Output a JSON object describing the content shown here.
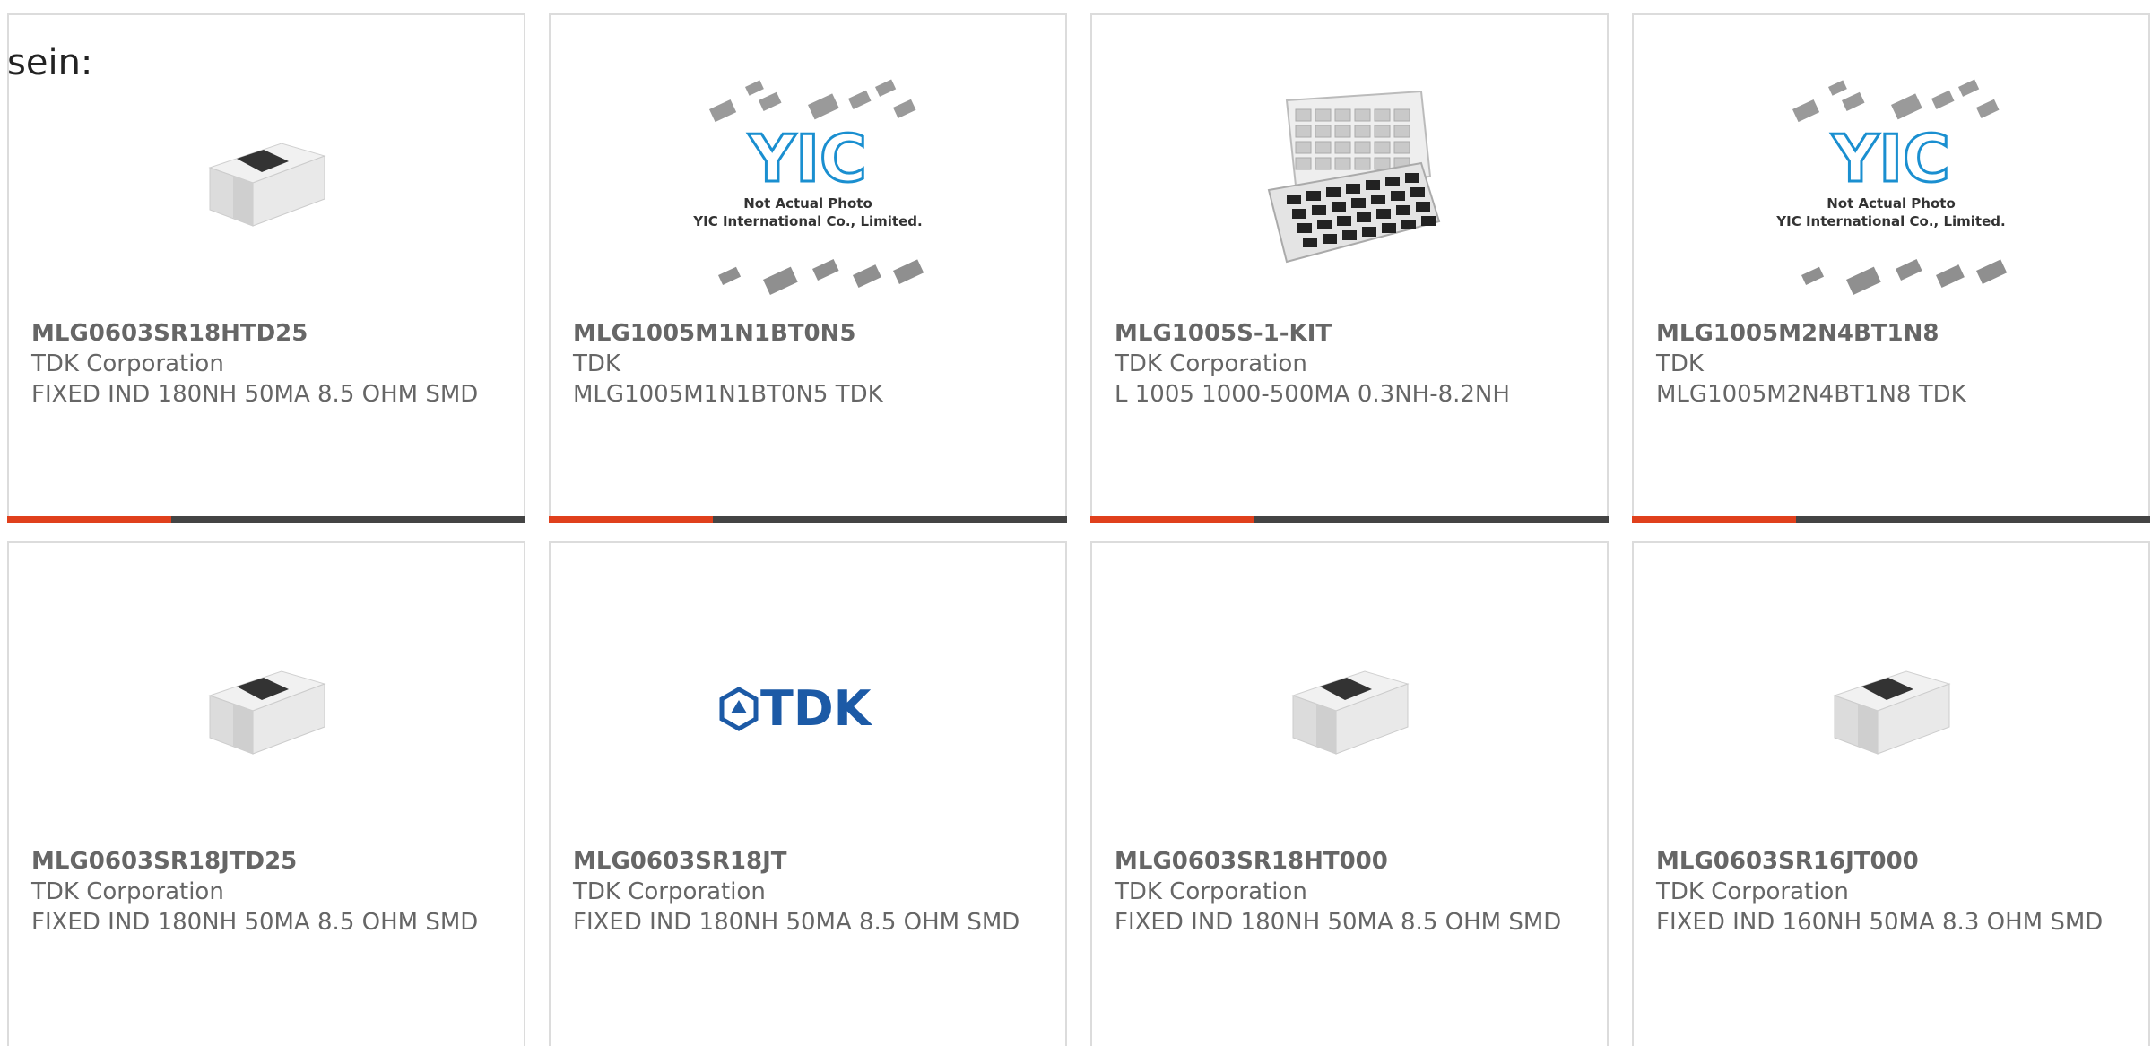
{
  "intro_text": "sein:",
  "products": [
    {
      "part": "MLG0603SR18HTD25",
      "maker": "TDK Corporation",
      "desc": "FIXED IND 180NH 50MA 8.5 OHM SMD",
      "image": "chip-inductor"
    },
    {
      "part": "MLG1005M1N1BT0N5",
      "maker": "TDK",
      "desc": "MLG1005M1N1BT0N5 TDK",
      "image": "yic-placeholder"
    },
    {
      "part": "MLG1005S-1-KIT",
      "maker": "TDK Corporation",
      "desc": "L 1005 1000-500MA 0.3NH-8.2NH",
      "image": "component-kit-box"
    },
    {
      "part": "MLG1005M2N4BT1N8",
      "maker": "TDK",
      "desc": "MLG1005M2N4BT1N8 TDK",
      "image": "yic-placeholder"
    },
    {
      "part": "MLG0603SR18JTD25",
      "maker": "TDK Corporation",
      "desc": "FIXED IND 180NH 50MA 8.5 OHM SMD",
      "image": "chip-inductor"
    },
    {
      "part": "MLG0603SR18JT",
      "maker": "TDK Corporation",
      "desc": "FIXED IND 180NH 50MA 8.5 OHM SMD",
      "image": "tdk-logo"
    },
    {
      "part": "MLG0603SR18HT000",
      "maker": "TDK Corporation",
      "desc": "FIXED IND 180NH 50MA 8.5 OHM SMD",
      "image": "chip-inductor"
    },
    {
      "part": "MLG0603SR16JT000",
      "maker": "TDK Corporation",
      "desc": "FIXED IND 160NH 50MA 8.3 OHM SMD",
      "image": "chip-inductor"
    }
  ],
  "placeholder": {
    "brand": "YIC",
    "line1": "Not Actual Photo",
    "line2": "YIC International Co., Limited."
  },
  "tdk_logo_text": "TDK",
  "colors": {
    "accent": "#e0401c",
    "bar_dark": "#444444",
    "text_gray": "#666666",
    "tdk_blue": "#1c5aa6",
    "yic_blue": "#1a8fd0"
  }
}
